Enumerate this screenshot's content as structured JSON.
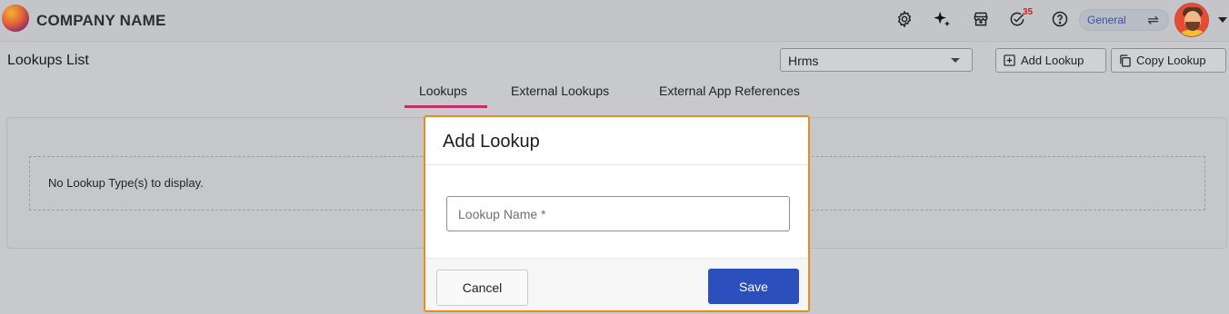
{
  "header": {
    "company_name": "COMPANY NAME",
    "icons": [
      "gear-icon",
      "sparkle-icon",
      "store-icon",
      "tasks-check-icon",
      "help-icon"
    ],
    "tasks_badge": "35",
    "workspace_label": "General",
    "swap_symbol": "⇌"
  },
  "page": {
    "title": "Lookups List",
    "module_select_value": "Hrms",
    "add_lookup_label": "Add Lookup",
    "copy_lookup_label": "Copy Lookup"
  },
  "tabs": [
    {
      "label": "Lookups",
      "active": true
    },
    {
      "label": "External Lookups",
      "active": false
    },
    {
      "label": "External App References",
      "active": false
    }
  ],
  "content": {
    "empty_message": "No Lookup Type(s) to display."
  },
  "modal": {
    "title": "Add Lookup",
    "input_placeholder": "Lookup Name *",
    "input_value": "",
    "cancel_label": "Cancel",
    "save_label": "Save"
  },
  "colors": {
    "tab_active_underline": "#c2316b",
    "modal_border": "#f0891d",
    "save_button": "#2c4fbe",
    "badge": "#d32020"
  }
}
